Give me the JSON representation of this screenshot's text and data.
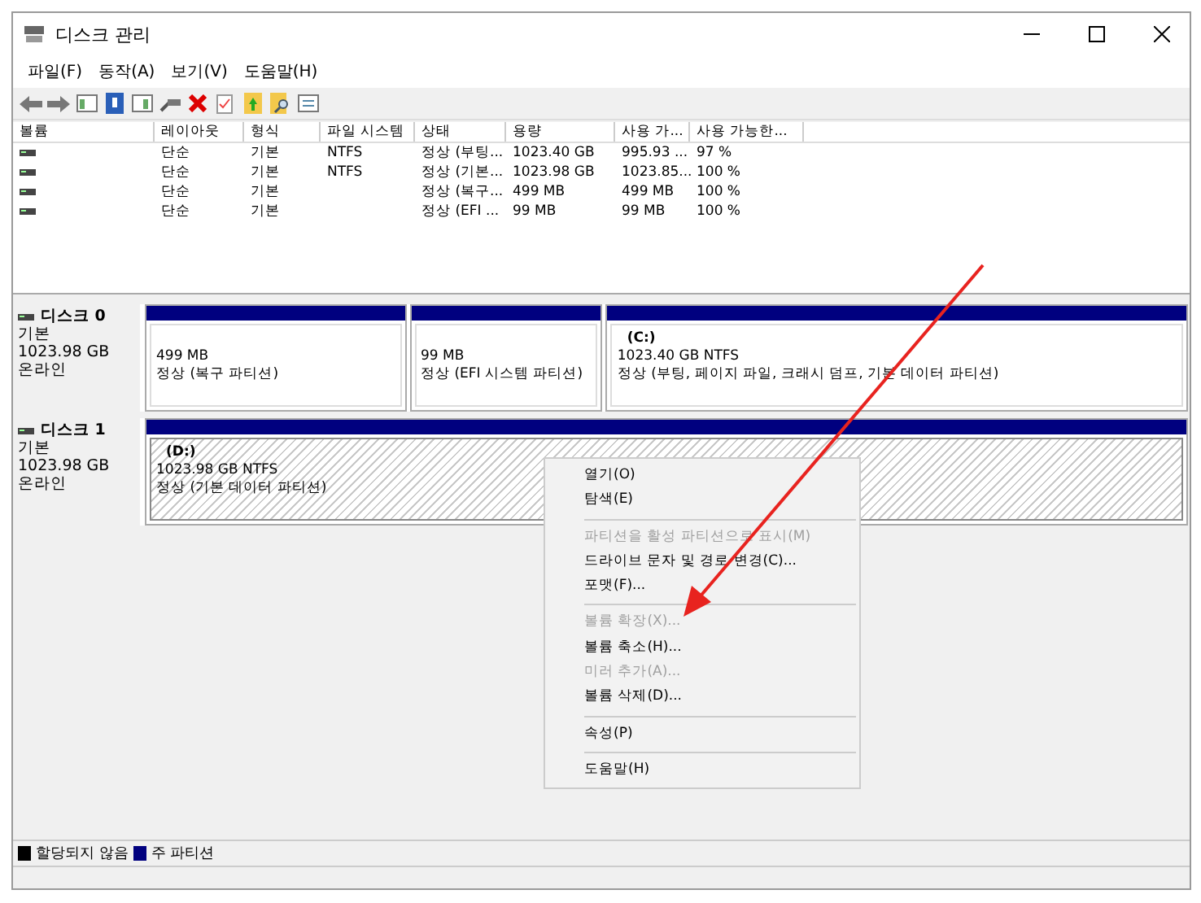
{
  "window": {
    "title": "디스크 관리"
  },
  "menu": [
    {
      "label": "파일(F)"
    },
    {
      "label": "동작(A)"
    },
    {
      "label": "보기(V)"
    },
    {
      "label": "도움말(H)"
    }
  ],
  "table": {
    "columns": [
      "볼륨",
      "레이아웃",
      "형식",
      "파일 시스템",
      "상태",
      "용량",
      "사용 가...",
      "사용 가능한..."
    ],
    "rows": [
      {
        "cells": [
          "",
          "단순",
          "기본",
          "NTFS",
          "정상 (부팅...",
          "1023.40 GB",
          "995.93 ...",
          "97 %"
        ]
      },
      {
        "cells": [
          "",
          "단순",
          "기본",
          "NTFS",
          "정상 (기본...",
          "1023.98 GB",
          "1023.85...",
          "100 %"
        ]
      },
      {
        "cells": [
          "",
          "단순",
          "기본",
          "",
          "정상 (복구...",
          "499 MB",
          "499 MB",
          "100 %"
        ]
      },
      {
        "cells": [
          "",
          "단순",
          "기본",
          "",
          "정상 (EFI ...",
          "99 MB",
          "99 MB",
          "100 %"
        ]
      }
    ]
  },
  "disks": [
    {
      "name": "디스크 0",
      "type": "기본",
      "size": "1023.98 GB",
      "status": "온라인",
      "partitions": [
        {
          "selected": false,
          "size": "499 MB",
          "status": "정상 (복구 파티션)"
        },
        {
          "selected": false,
          "size": "99 MB",
          "status": "정상 (EFI 시스템 파티션)"
        },
        {
          "selected": false,
          "label": "(C:)",
          "size": "1023.40 GB NTFS",
          "status": "정상 (부팅, 페이지 파일, 크래시 덤프, 기본 데이터 파티션)"
        }
      ]
    },
    {
      "name": "디스크 1",
      "type": "기본",
      "size": "1023.98 GB",
      "status": "온라인",
      "partitions": [
        {
          "selected": true,
          "label": "(D:)",
          "size": "1023.98 GB NTFS",
          "status": "정상 (기본 데이터 파티션)"
        }
      ]
    }
  ],
  "context_menu": [
    {
      "kind": "item",
      "label": "열기(O)",
      "disabled": false
    },
    {
      "kind": "item",
      "label": "탐색(E)",
      "disabled": false
    },
    {
      "kind": "separator"
    },
    {
      "kind": "item",
      "label": "파티션을 활성 파티션으로 표시(M)",
      "disabled": true
    },
    {
      "kind": "item",
      "label": "드라이브 문자 및 경로 변경(C)...",
      "disabled": false
    },
    {
      "kind": "item",
      "label": "포맷(F)...",
      "disabled": false
    },
    {
      "kind": "separator"
    },
    {
      "kind": "item",
      "label": "볼륨 확장(X)...",
      "disabled": true
    },
    {
      "kind": "item",
      "label": "볼륨 축소(H)...",
      "disabled": false
    },
    {
      "kind": "item",
      "label": "미러 추가(A)...",
      "disabled": true
    },
    {
      "kind": "item",
      "label": "볼륨 삭제(D)...",
      "disabled": false
    },
    {
      "kind": "separator"
    },
    {
      "kind": "item",
      "label": "속성(P)",
      "disabled": false
    },
    {
      "kind": "separator"
    },
    {
      "kind": "item",
      "label": "도움말(H)",
      "disabled": false
    }
  ],
  "legend": [
    {
      "label": "할당되지 않음",
      "color": "#000000"
    },
    {
      "label": "주 파티션",
      "color": "#00007f"
    }
  ]
}
